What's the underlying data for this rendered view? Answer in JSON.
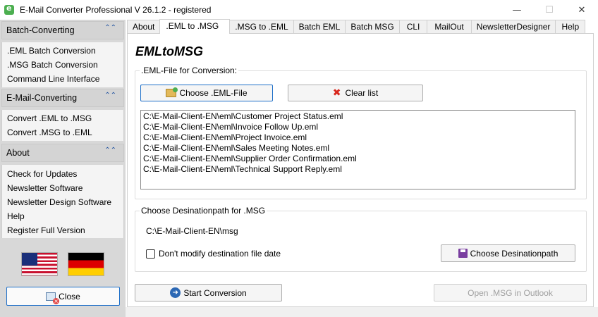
{
  "window": {
    "title": "E-Mail Converter Professional V 26.1.2 - registered",
    "app_icon": "app-logo-icon",
    "controls": {
      "minimize": "—",
      "maximize": "☐",
      "close": "✕"
    }
  },
  "sidebar": {
    "sections": [
      {
        "title": "Batch-Converting",
        "items": [
          ".EML Batch Conversion",
          ".MSG Batch Conversion",
          "Command Line Interface"
        ]
      },
      {
        "title": "E-Mail-Converting",
        "items": [
          "Convert .EML to .MSG",
          "Convert .MSG to .EML"
        ]
      },
      {
        "title": "About",
        "items": [
          "Check for Updates",
          "Newsletter Software",
          "Newsletter Design Software",
          "Help",
          "Register Full Version"
        ]
      }
    ],
    "collapse_glyph": "⌃⌃",
    "flags": [
      "us-flag",
      "german-flag"
    ],
    "close_label": "Close"
  },
  "tabs": [
    "About",
    ".EML to .MSG",
    ".MSG to .EML",
    "Batch EML",
    "Batch MSG",
    "CLI",
    "MailOut",
    "NewsletterDesigner",
    "Help"
  ],
  "active_tab": ".EML to .MSG",
  "main": {
    "heading": "EMLtoMSG",
    "eml_group": {
      "label": ".EML-File for Conversion:",
      "choose_button": "Choose .EML-File",
      "clear_button": "Clear list",
      "files": [
        "C:\\E-Mail-Client-EN\\eml\\Customer Project Status.eml",
        "C:\\E-Mail-Client-EN\\eml\\Invoice Follow Up.eml",
        "C:\\E-Mail-Client-EN\\eml\\Project Invoice.eml",
        "C:\\E-Mail-Client-EN\\eml\\Sales Meeting Notes.eml",
        "C:\\E-Mail-Client-EN\\eml\\Supplier Order Confirmation.eml",
        "C:\\E-Mail-Client-EN\\eml\\Technical Support Reply.eml"
      ]
    },
    "dest_group": {
      "label": "Choose Desinationpath for .MSG",
      "path": "C:\\E-Mail-Client-EN\\msg",
      "checkbox_label": "Don't modify destination file date",
      "checkbox_checked": false,
      "choose_button": "Choose Desinationpath"
    },
    "start_button": "Start Conversion",
    "open_button": "Open .MSG in Outlook"
  },
  "colors": {
    "accent": "#1e6fc8",
    "sidebar_bg": "#d8d8d8",
    "clear_icon": "#d8261c"
  }
}
